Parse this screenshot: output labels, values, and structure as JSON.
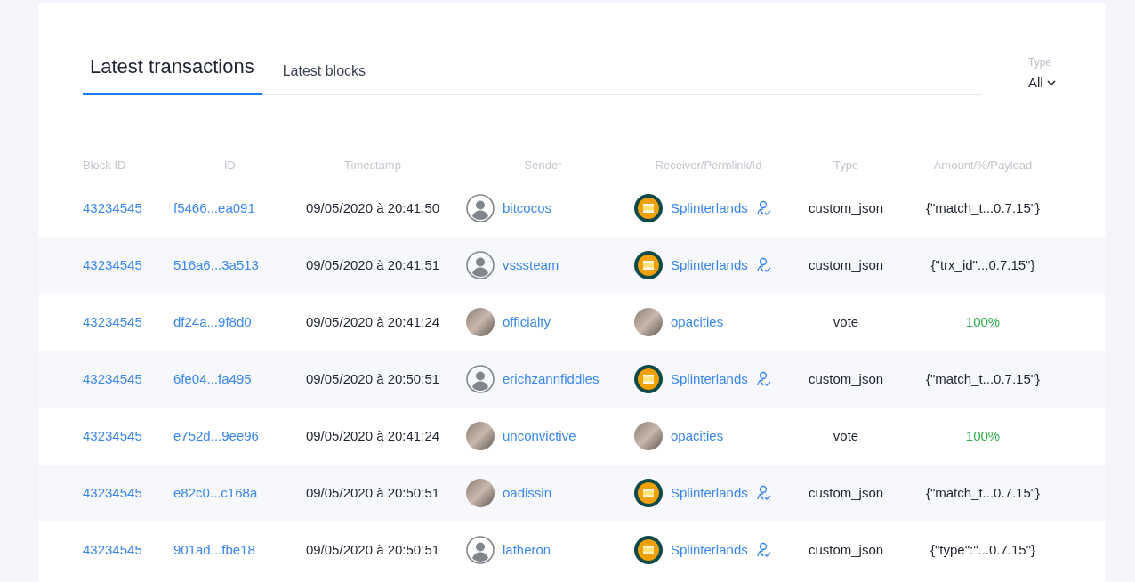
{
  "tabs": [
    {
      "label": "Latest transactions",
      "selected": true
    },
    {
      "label": "Latest blocks",
      "selected": false
    }
  ],
  "type_filter": {
    "label": "Type",
    "value": "All"
  },
  "columns": [
    "Block ID",
    "ID",
    "Timestamp",
    "Sender",
    "Receiver/Permlink/Id",
    "Type",
    "Amount/%/Payload"
  ],
  "rows": [
    {
      "block_id": "43234545",
      "id": "f5466...ea091",
      "timestamp": "09/05/2020 à 20:41:50",
      "sender": {
        "name": "bitcocos",
        "kind": "default"
      },
      "receiver": {
        "name": "Splinterlands",
        "kind": "logo",
        "verified": true
      },
      "type": "custom_json",
      "amount": {
        "text": "{\"match_t...0.7.15\"}",
        "kind": "payload"
      }
    },
    {
      "block_id": "43234545",
      "id": "516a6...3a513",
      "timestamp": "09/05/2020 à 20:41:51",
      "sender": {
        "name": "vsssteam",
        "kind": "default"
      },
      "receiver": {
        "name": "Splinterlands",
        "kind": "logo",
        "verified": true
      },
      "type": "custom_json",
      "amount": {
        "text": "{\"trx_id\"...0.7.15\"}",
        "kind": "payload"
      }
    },
    {
      "block_id": "43234545",
      "id": "df24a...9f8d0",
      "timestamp": "09/05/2020 à 20:41:24",
      "sender": {
        "name": "officialty",
        "kind": "photo"
      },
      "receiver": {
        "name": "opacities",
        "kind": "photo",
        "verified": false
      },
      "type": "vote",
      "amount": {
        "text": "100%",
        "kind": "percent"
      }
    },
    {
      "block_id": "43234545",
      "id": "6fe04...fa495",
      "timestamp": "09/05/2020 à 20:50:51",
      "sender": {
        "name": "erichzannfiddles",
        "kind": "default"
      },
      "receiver": {
        "name": "Splinterlands",
        "kind": "logo",
        "verified": true
      },
      "type": "custom_json",
      "amount": {
        "text": "{\"match_t...0.7.15\"}",
        "kind": "payload"
      }
    },
    {
      "block_id": "43234545",
      "id": "e752d...9ee96",
      "timestamp": "09/05/2020 à 20:41:24",
      "sender": {
        "name": "unconvictive",
        "kind": "photo"
      },
      "receiver": {
        "name": "opacities",
        "kind": "photo",
        "verified": false
      },
      "type": "vote",
      "amount": {
        "text": "100%",
        "kind": "percent"
      }
    },
    {
      "block_id": "43234545",
      "id": "e82c0...c168a",
      "timestamp": "09/05/2020 à 20:50:51",
      "sender": {
        "name": "oadissin",
        "kind": "photo"
      },
      "receiver": {
        "name": "Splinterlands",
        "kind": "logo",
        "verified": true
      },
      "type": "custom_json",
      "amount": {
        "text": "{\"match_t...0.7.15\"}",
        "kind": "payload"
      }
    },
    {
      "block_id": "43234545",
      "id": "901ad...fbe18",
      "timestamp": "09/05/2020 à 20:50:51",
      "sender": {
        "name": "latheron",
        "kind": "default"
      },
      "receiver": {
        "name": "Splinterlands",
        "kind": "logo",
        "verified": true
      },
      "type": "custom_json",
      "amount": {
        "text": "{\"type\":\"...0.7.15\"}",
        "kind": "payload"
      }
    }
  ]
}
